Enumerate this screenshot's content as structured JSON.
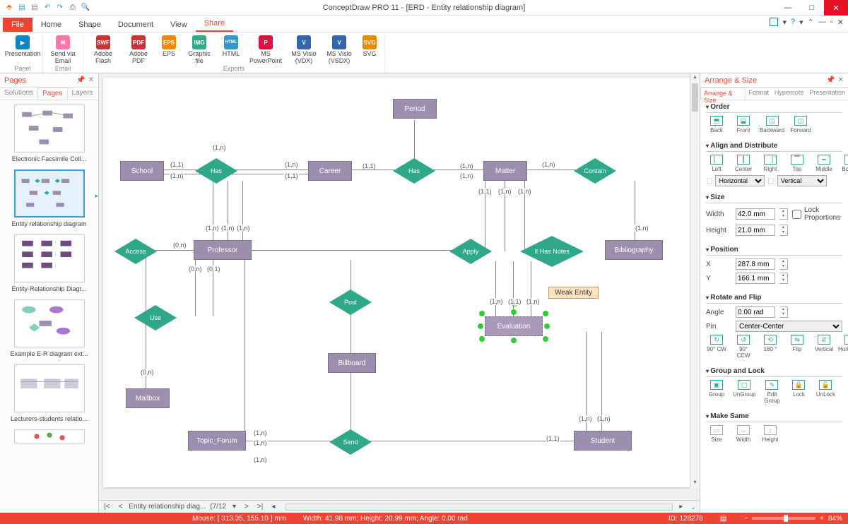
{
  "title": "ConceptDraw PRO 11 - [ERD - Entity relationship diagram]",
  "tabs": {
    "file": "File",
    "home": "Home",
    "shape": "Shape",
    "document": "Document",
    "view": "View",
    "share": "Share"
  },
  "ribbon": {
    "groups": {
      "panel": "Panel",
      "email": "Email",
      "exports": "Exports"
    },
    "btns": {
      "presentation": "Presentation",
      "send_email": "Send via\nEmail",
      "flash": "Adobe\nFlash",
      "pdf": "Adobe\nPDF",
      "eps": "EPS",
      "graphic": "Graphic\nfile",
      "html": "HTML",
      "ppt": "MS\nPowerPoint",
      "vdx": "MS Visio\n(VDX)",
      "vsdx": "MS Visio\n(VSDX)",
      "svg": "SVG"
    }
  },
  "pages_panel": {
    "title": "Pages",
    "tabs": {
      "solutions": "Solutions",
      "pages": "Pages",
      "layers": "Layers"
    },
    "thumbs": [
      "Electronic Facsimile Coll...",
      "Entity relationship diagram",
      "Entity-Relationship Diagr...",
      "Example E-R diagram ext...",
      "Lecturers-students relatio..."
    ]
  },
  "sheet": {
    "name": "Entity relationship diag...",
    "counter": "(7/12"
  },
  "arrange": {
    "title": "Arrange & Size",
    "tabs": {
      "arrange": "Arrange & Size",
      "format": "Format",
      "hypernote": "Hypernote",
      "presentation": "Presentation"
    },
    "order": {
      "h": "Order",
      "back": "Back",
      "front": "Front",
      "backward": "Backward",
      "forward": "Forward"
    },
    "align": {
      "h": "Align and Distribute",
      "left": "Left",
      "center": "Center",
      "right": "Right",
      "top": "Top",
      "middle": "Middle",
      "bottom": "Bottom",
      "horiz": "Horizontal",
      "vert": "Vertical"
    },
    "size": {
      "h": "Size",
      "width_l": "Width",
      "width_v": "42.0 mm",
      "height_l": "Height",
      "height_v": "21.0 mm",
      "lock": "Lock Proportions"
    },
    "pos": {
      "h": "Position",
      "x_l": "X",
      "x_v": "287.8 mm",
      "y_l": "Y",
      "y_v": "166.1 mm"
    },
    "rotate": {
      "h": "Rotate and Flip",
      "angle_l": "Angle",
      "angle_v": "0.00 rad",
      "pin_l": "Pin",
      "pin_v": "Center-Center",
      "cw": "90° CW",
      "ccw": "90° CCW",
      "r180": "180 °",
      "flip": "Flip",
      "fv": "Vertical",
      "fh": "Horizontal"
    },
    "group": {
      "h": "Group and Lock",
      "group": "Group",
      "ungroup": "UnGroup",
      "edit": "Edit\nGroup",
      "lock": "Lock",
      "unlock": "UnLock"
    },
    "same": {
      "h": "Make Same",
      "size": "Size",
      "width": "Width",
      "height": "Height"
    }
  },
  "tooltip": "Weak Entity",
  "erd": {
    "entities": {
      "period": "Period",
      "school": "School",
      "career": "Career",
      "matter": "Matter",
      "professor": "Professor",
      "bibliography": "Bibliography",
      "billboard": "Billboard",
      "mailbox": "Mailbox",
      "topic_forum": "Topic_Forum",
      "student": "Student",
      "evaluation": "Evaluation"
    },
    "rels": {
      "has1": "Has",
      "has2": "Has",
      "contain": "Contain",
      "access": "Access",
      "apply": "Apply",
      "ithasnotes": "It Has Notes",
      "post": "Post",
      "use": "Use",
      "send": "Send"
    },
    "cards": {
      "c11": "(1,1)",
      "c1n": "(1,n)",
      "c0n": "(0,n)",
      "c01": "(0,1)"
    }
  },
  "status": {
    "mouse": "Mouse: [ 313.35, 155.10 ] mm",
    "dims": "Width: 41.98 mm;   Height: 20.99 mm;  Angle: 0.00 rad",
    "id": "ID: 128278",
    "zoom": "84%"
  }
}
